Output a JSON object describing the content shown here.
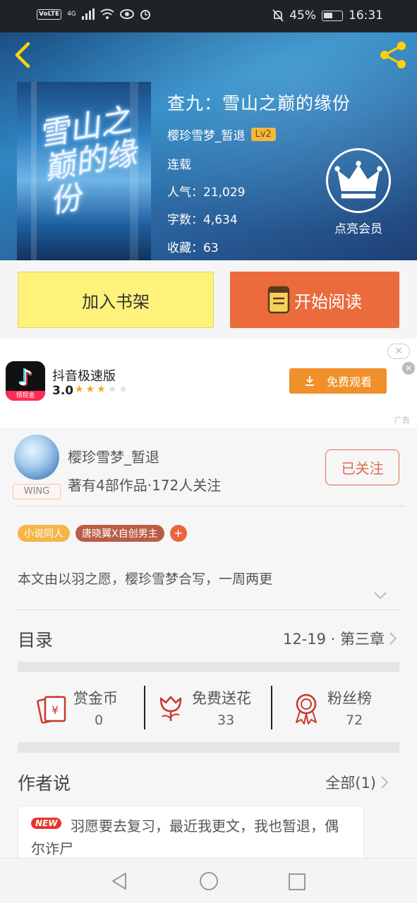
{
  "status_bar": {
    "volte": "VoLTE",
    "signal": "4G",
    "battery": "45%",
    "time": "16:31"
  },
  "book": {
    "title": "查九：雪山之巅的缘份",
    "author": "樱珍雪梦_暂退",
    "level": "Lv2",
    "status": "连载",
    "popularity": "人气：21,029",
    "words": "字数：4,634",
    "favorites": "收藏：63",
    "cover_text": "雪山之巅的缘份",
    "vip_label": "点亮会员"
  },
  "actions": {
    "add_shelf": "加入书架",
    "start_read": "开始阅读"
  },
  "ad": {
    "app_name": "抖音极速版",
    "rating": "3.0",
    "rating_value": 3,
    "rating_max": 5,
    "cta": "免费观看",
    "icon_tag": "领现金",
    "ad_label": "广告"
  },
  "author": {
    "name": "樱珍雪梦_暂退",
    "stats": "著有4部作品·172人关注",
    "badge": "WING",
    "follow_label": "已关注"
  },
  "tags": [
    "小说同人",
    "唐晓翼X自创男主"
  ],
  "tag_add": "+",
  "description": "本文由以羽之愿，樱珍雪梦合写，一周两更",
  "toc": {
    "title": "目录",
    "latest": "12-19 · 第三章"
  },
  "stats": [
    {
      "label": "赏金币",
      "value": "0"
    },
    {
      "label": "免费送花",
      "value": "33"
    },
    {
      "label": "粉丝榜",
      "value": "72"
    }
  ],
  "author_said": {
    "title": "作者说",
    "all": "全部(1)",
    "badge": "NEW",
    "text": "羽愿要去复习，最近我更文，我也暂退，偶尔诈尸"
  },
  "colors": {
    "accent": "#eb6b3c",
    "shelf": "#fff27a",
    "tag_yellow": "#f5b647"
  }
}
